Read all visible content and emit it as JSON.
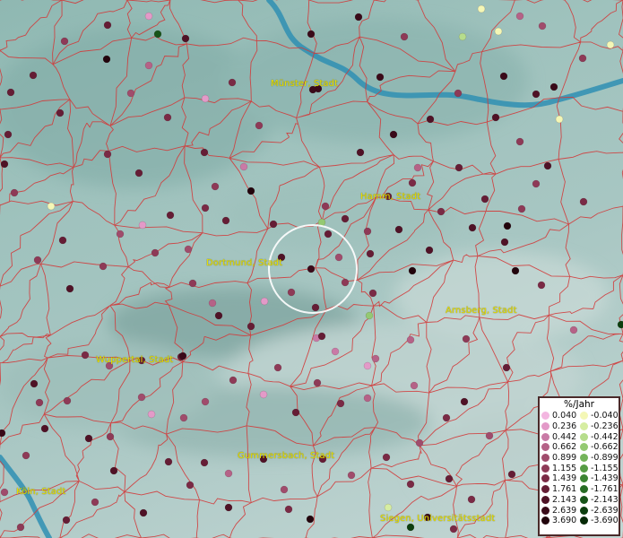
{
  "map": {
    "cities": [
      {
        "key": "muenster",
        "label": "Münster, Stadt"
      },
      {
        "key": "hamm",
        "label": "Hamm, Stadt"
      },
      {
        "key": "dortmund",
        "label": "Dortmund, Stadt"
      },
      {
        "key": "arnsberg",
        "label": "Arnsberg, Stadt"
      },
      {
        "key": "wuppertal",
        "label": "Wuppertal, Stadt"
      },
      {
        "key": "gummersbach",
        "label": "Gummersbach, Stadt"
      },
      {
        "key": "koeln",
        "label": "Köln, Stadt"
      },
      {
        "key": "siegen",
        "label": "Siegen, Universitätsstadt"
      }
    ]
  },
  "legend": {
    "title": "%/Jahr",
    "positive": [
      {
        "value": "0.040",
        "color": "#f3b6e0"
      },
      {
        "value": "0.236",
        "color": "#e39ac8"
      },
      {
        "value": "0.442",
        "color": "#c97aa6"
      },
      {
        "value": "0.662",
        "color": "#b56287"
      },
      {
        "value": "0.899",
        "color": "#a04c6c"
      },
      {
        "value": "1.155",
        "color": "#8e3a57"
      },
      {
        "value": "1.439",
        "color": "#7a2a45"
      },
      {
        "value": "1.761",
        "color": "#651d35"
      },
      {
        "value": "2.143",
        "color": "#4f1226"
      },
      {
        "value": "2.639",
        "color": "#3a0a19"
      },
      {
        "value": "3.690",
        "color": "#22040c"
      }
    ],
    "negative": [
      {
        "value": "-0.040",
        "color": "#f4f7b6"
      },
      {
        "value": "-0.236",
        "color": "#d6eda2"
      },
      {
        "value": "-0.442",
        "color": "#b6dd8c"
      },
      {
        "value": "-0.662",
        "color": "#94c972"
      },
      {
        "value": "-0.899",
        "color": "#74b45a"
      },
      {
        "value": "-1.155",
        "color": "#569c44"
      },
      {
        "value": "-1.439",
        "color": "#3c8432"
      },
      {
        "value": "-1.761",
        "color": "#276c24"
      },
      {
        "value": "-2.143",
        "color": "#175418"
      },
      {
        "value": "-2.639",
        "color": "#0c3e0e"
      },
      {
        "value": "-3.690",
        "color": "#052806"
      }
    ]
  }
}
